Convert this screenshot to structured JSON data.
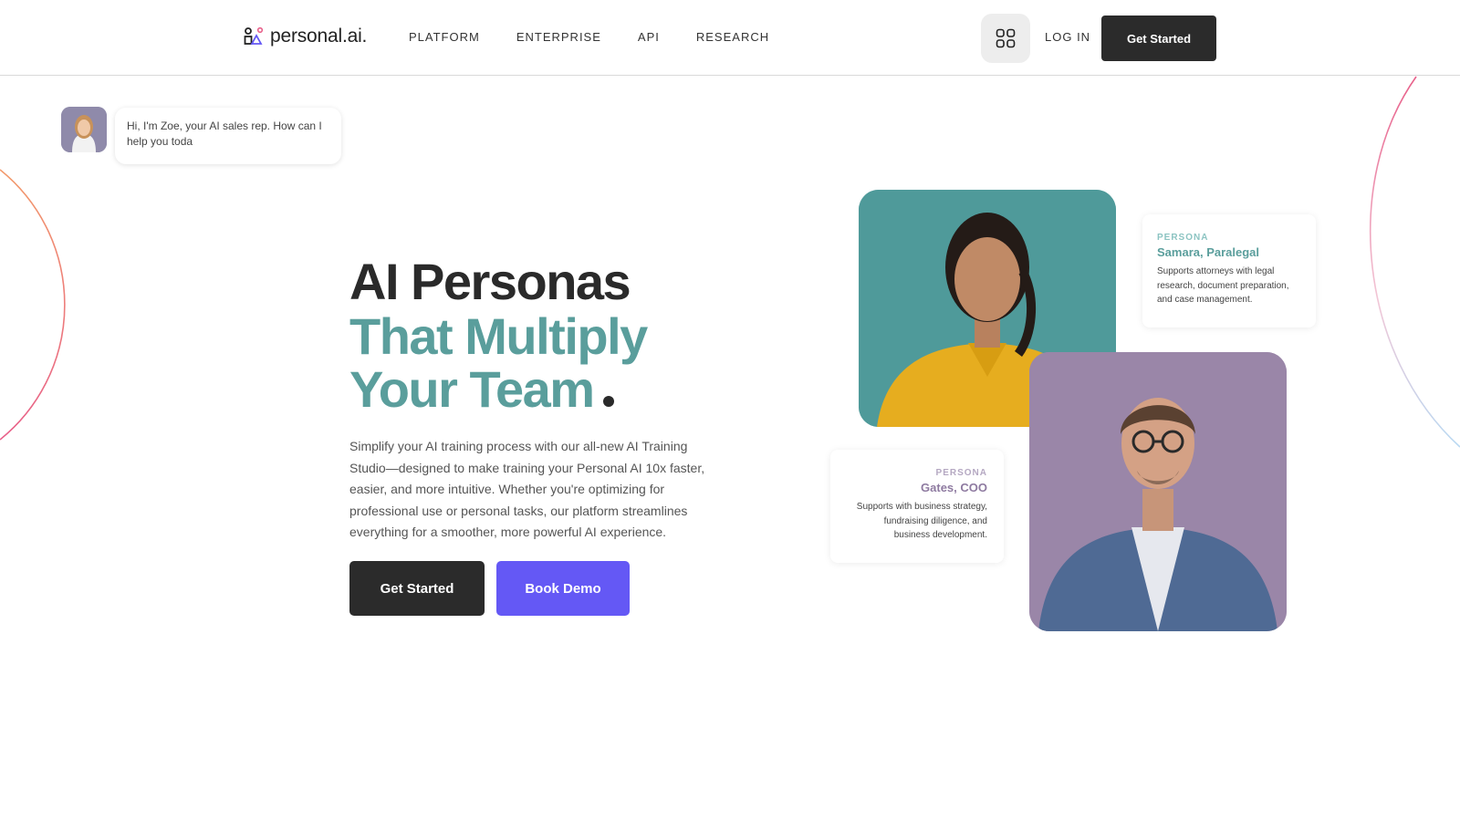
{
  "header": {
    "logo_text": "personal.ai.",
    "nav": [
      {
        "label": "PLATFORM"
      },
      {
        "label": "ENTERPRISE"
      },
      {
        "label": "API"
      },
      {
        "label": "RESEARCH"
      }
    ],
    "apps_icon": "grid-icon",
    "login_label": "LOG IN",
    "cta_label": "Get Started"
  },
  "chat": {
    "avatar_icon": "zoe-avatar",
    "message": "Hi, I'm Zoe, your AI sales rep. How can I help you toda"
  },
  "hero": {
    "title_line1": "AI Personas",
    "title_line2": "That Multiply Your Team",
    "description": "Simplify your AI training process with our all-new AI Training Studio—designed to make training your Personal AI 10x faster, easier, and more intuitive. Whether you're optimizing for professional use or personal tasks, our platform streamlines everything for a smoother, more powerful AI experience.",
    "primary_cta": "Get Started",
    "secondary_cta": "Book Demo"
  },
  "personas": [
    {
      "kicker": "PERSONA",
      "name": "Samara, Paralegal",
      "description": "Supports attorneys with legal research, document preparation, and case management."
    },
    {
      "kicker": "PERSONA",
      "name": "Gates, COO",
      "description": "Supports with business strategy, fundraising diligence, and business development."
    }
  ],
  "colors": {
    "accent_teal": "#5a9e9c",
    "accent_purple": "#6458f5",
    "dark": "#2b2b2b"
  }
}
